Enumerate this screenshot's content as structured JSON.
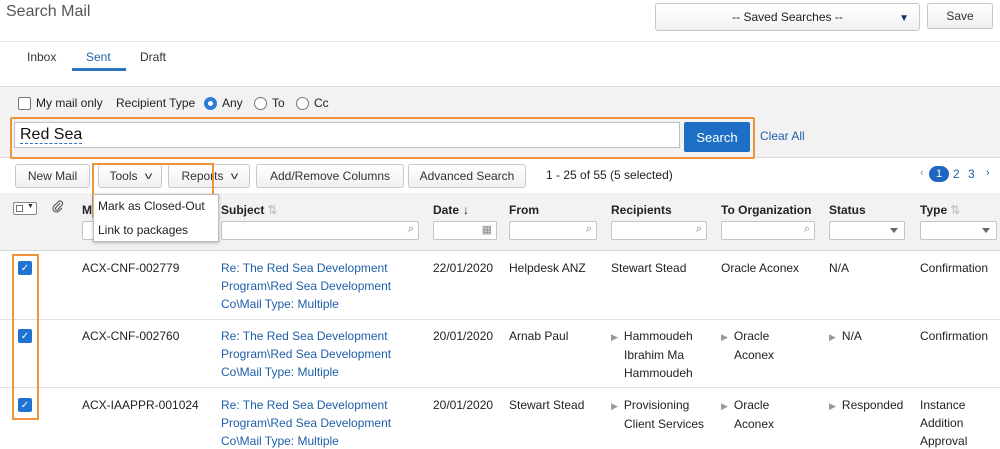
{
  "header": {
    "title": "Search Mail",
    "saved_searches": "-- Saved Searches --",
    "save_label": "Save"
  },
  "tabs": [
    {
      "label": "Inbox",
      "active": false
    },
    {
      "label": "Sent",
      "active": true
    },
    {
      "label": "Draft",
      "active": false
    }
  ],
  "filters": {
    "my_mail_only": "My mail only",
    "recipient_type_label": "Recipient Type",
    "recipient_options": [
      "Any",
      "To",
      "Cc"
    ],
    "selected_recipient": "Any"
  },
  "search": {
    "query": "Red Sea",
    "button": "Search",
    "clear_all": "Clear All"
  },
  "toolbar": {
    "new_mail": "New Mail",
    "tools": "Tools",
    "reports": "Reports",
    "add_remove_columns": "Add/Remove Columns",
    "advanced_search": "Advanced Search",
    "count_text": "1 - 25 of 55 (5 selected)"
  },
  "pager": {
    "prev": "‹",
    "pages": [
      "1",
      "2",
      "3"
    ],
    "current": "1",
    "next": "›"
  },
  "tools_menu": [
    "Mark as Closed-Out",
    "Link to packages"
  ],
  "columns": {
    "mail_no": "M",
    "subject": "Subject",
    "date": "Date",
    "from": "From",
    "recipients": "Recipients",
    "to_org": "To Organization",
    "status": "Status",
    "type": "Type"
  },
  "rows": [
    {
      "selected": true,
      "mail_no": "ACX-CNF-002779",
      "subject": [
        "Re: The Red Sea Development",
        "Program\\Red Sea Development",
        "Co\\Mail Type: Multiple"
      ],
      "date": "22/01/2020",
      "from": "Helpdesk ANZ",
      "recipients": [
        "Stewart Stead"
      ],
      "to_org": [
        "Oracle Aconex"
      ],
      "status": "N/A",
      "type": [
        "Confirmation"
      ]
    },
    {
      "selected": true,
      "mail_no": "ACX-CNF-002760",
      "subject": [
        "Re: The Red Sea Development",
        "Program\\Red Sea Development",
        "Co\\Mail Type: Multiple"
      ],
      "date": "20/01/2020",
      "from": "Arnab Paul",
      "recipients": [
        "Hammoudeh",
        "Ibrahim Ma",
        "Hammoudeh"
      ],
      "to_org": [
        "Oracle",
        "Aconex"
      ],
      "status": "N/A",
      "type": [
        "Confirmation"
      ]
    },
    {
      "selected": true,
      "mail_no": "ACX-IAAPPR-001024",
      "subject": [
        "Re: The Red Sea Development",
        "Program\\Red Sea Development",
        "Co\\Mail Type: Multiple"
      ],
      "date": "20/01/2020",
      "from": "Stewart Stead",
      "recipients": [
        "Provisioning",
        "Client Services"
      ],
      "to_org": [
        "Oracle",
        "Aconex"
      ],
      "status": "Responded",
      "type": [
        "Instance",
        "Addition",
        "Approval"
      ]
    }
  ],
  "colors": {
    "accent": "#1c6fc4",
    "highlight": "#f0943a",
    "link": "#1f5fa8"
  }
}
